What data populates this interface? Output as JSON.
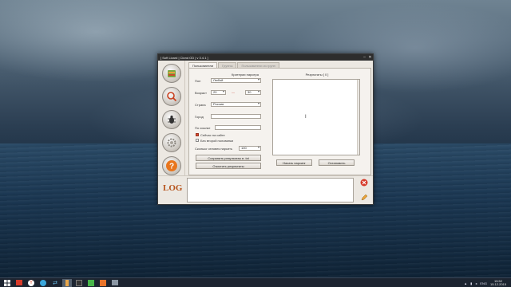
{
  "window": {
    "title": "[ Soft Lizard | Clond OD | v 3.4.1 ]"
  },
  "tabs": [
    {
      "label": "Пользователи"
    },
    {
      "label": "Группы"
    },
    {
      "label": "Пользователи из групп"
    }
  ],
  "search_panel": {
    "title": "Критерии парсера",
    "gender_label": "Пол",
    "gender_value": "Любой",
    "age_label": "Возраст",
    "age_from": "20",
    "age_dash": "—",
    "age_to": "30",
    "country_label": "Страна",
    "country_value": "Россия",
    "city_label": "Город",
    "city_value": "",
    "by_link_label": "По ссылке",
    "by_link_value": "",
    "online_label": "Сейчас на сайте",
    "online_checked": true,
    "no_partner_label": "Без второй половинки",
    "no_partner_checked": false,
    "count_label": "Сколько человек парсить",
    "count_value": "100",
    "save_button": "Сохранить результаты в .txt",
    "clear_button": "Очистить результаты"
  },
  "results_panel": {
    "title": "Результаты [ 0 ]",
    "start_button": "Начать парсинг",
    "stop_button": "Остановить"
  },
  "log": {
    "title": "LOG"
  },
  "taskbar": {
    "lang": "ENG",
    "time": "15:52",
    "date": "15.12.2015"
  }
}
